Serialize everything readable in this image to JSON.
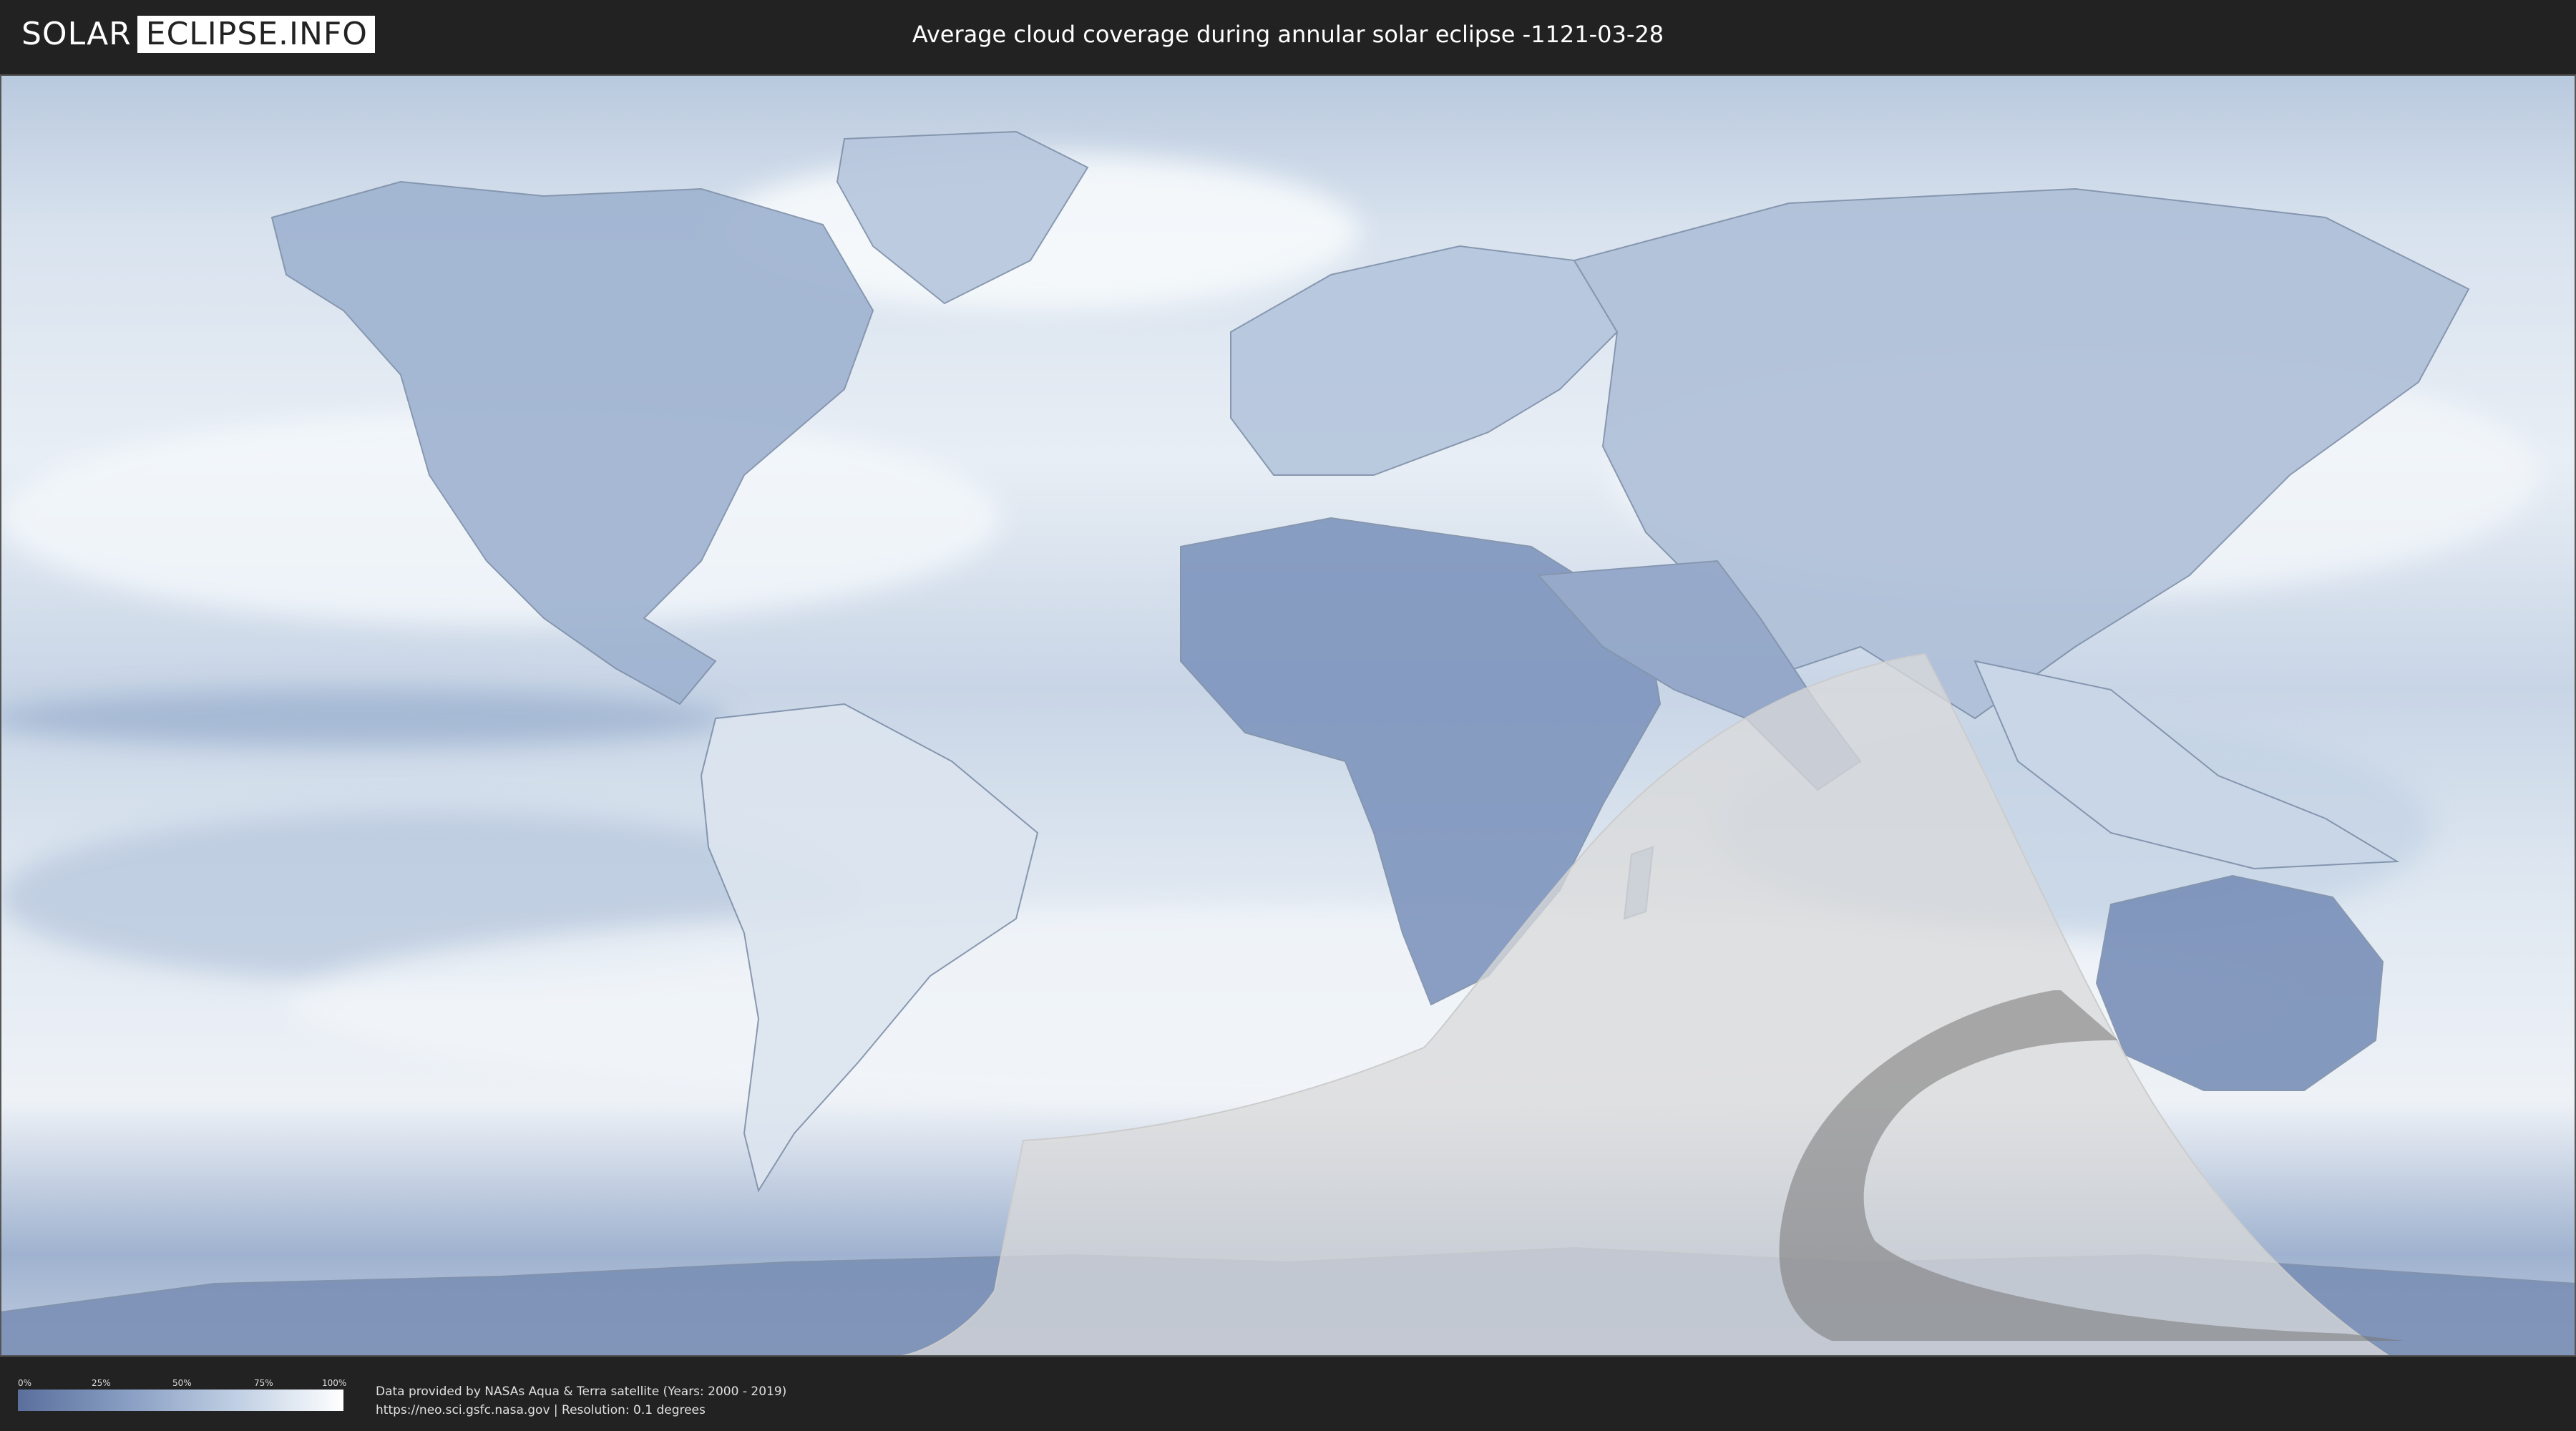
{
  "header": {
    "logo_left": "SOLAR",
    "logo_right": "ECLIPSE.INFO",
    "title": "Average cloud coverage during annular solar eclipse -1121-03-28"
  },
  "legend": {
    "ticks": [
      "0%",
      "25%",
      "50%",
      "75%",
      "100%"
    ]
  },
  "footer": {
    "credit_line1": "Data provided by NASAs Aqua & Terra satellite (Years: 2000 - 2019)",
    "credit_line2": "https://neo.sci.gsfc.nasa.gov | Resolution: 0.1 degrees"
  },
  "colors": {
    "background": "#222222",
    "clear_sky": "#5a6f9c",
    "overcast": "#ffffff",
    "eclipse_penumbra": "#d9d9d9",
    "eclipse_path": "#777777"
  }
}
